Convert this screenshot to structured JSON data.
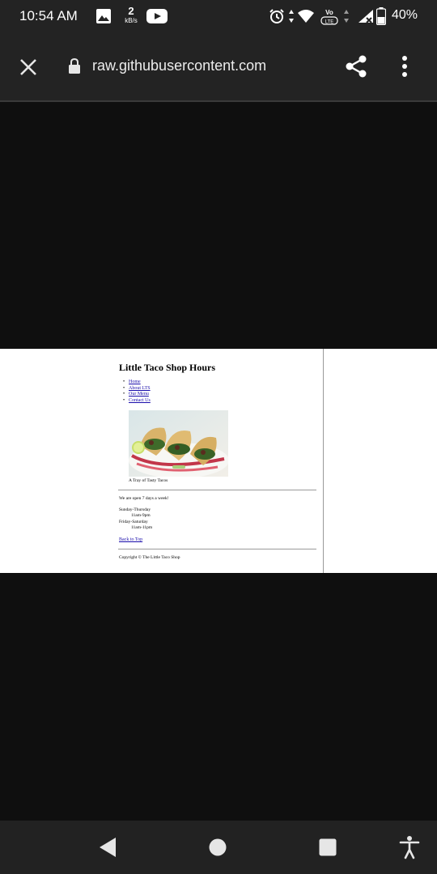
{
  "status_bar": {
    "time": "10:54 AM",
    "net_speed_value": "2",
    "net_speed_unit": "kB/s",
    "volte_label": "VoLTE",
    "battery_pct": "40%",
    "icons": [
      "gallery-icon",
      "youtube-icon",
      "alarm-icon",
      "wifi-icon",
      "volte-icon",
      "signal-icon",
      "battery-icon"
    ]
  },
  "toolbar": {
    "url": "raw.githubusercontent.com",
    "icons": [
      "close-icon",
      "lock-icon",
      "share-icon",
      "more-vert-icon"
    ]
  },
  "page": {
    "title": "Little Taco Shop Hours",
    "nav": [
      {
        "label": "Home"
      },
      {
        "label": "About LTS"
      },
      {
        "label": "Our Menu"
      },
      {
        "label": "Contact Us"
      }
    ],
    "image_caption": "A Tray of Tasty Tacos",
    "open_text": "We are open 7 days a week!",
    "hours": [
      {
        "days": "Sunday-Thursday",
        "time": "11am-9pm"
      },
      {
        "days": "Friday-Saturday",
        "time": "11am-11pm"
      }
    ],
    "back_to_top": "Back to Top",
    "copyright": "Copyright © The Little Taco Shop"
  },
  "nav_bar": {
    "icons": [
      "back-icon",
      "home-icon",
      "recents-icon",
      "accessibility-icon"
    ]
  },
  "colors": {
    "status_bg": "#232323",
    "page_bg": "#ffffff",
    "dark_bg": "#0f0f0f",
    "link": "#1a0dab"
  }
}
